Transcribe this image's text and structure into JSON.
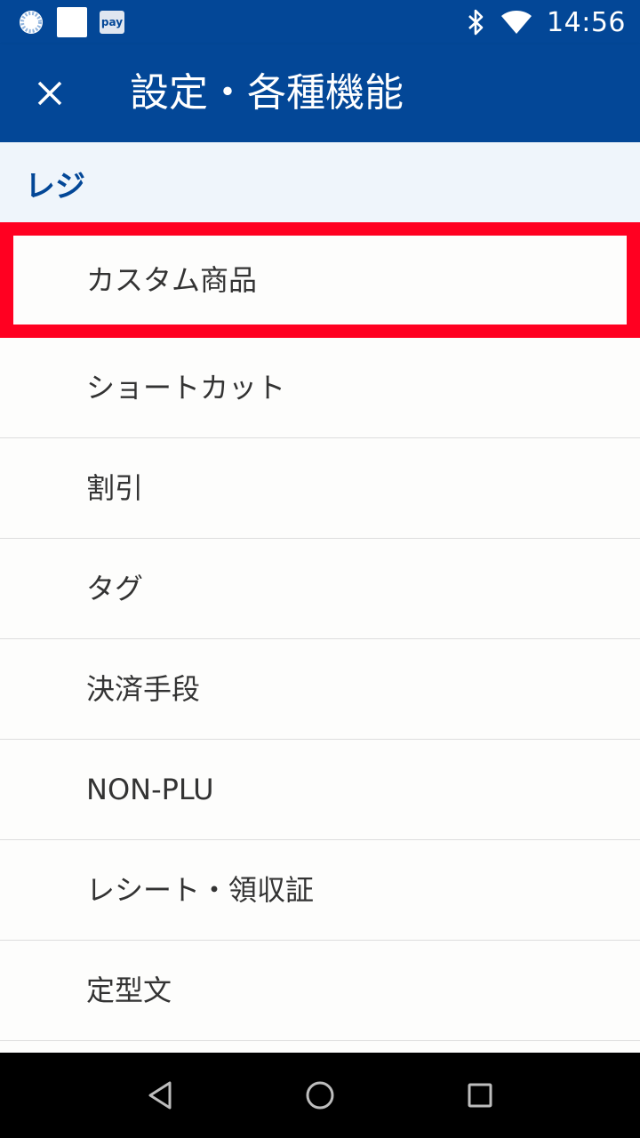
{
  "status_bar": {
    "pay_badge": "pay",
    "time": "14:56"
  },
  "app_bar": {
    "title": "設定・各種機能"
  },
  "section": {
    "title": "レジ"
  },
  "menu": {
    "items": [
      {
        "label": "カスタム商品",
        "highlighted": true
      },
      {
        "label": "ショートカット"
      },
      {
        "label": "割引"
      },
      {
        "label": "タグ"
      },
      {
        "label": "決済手段"
      },
      {
        "label": "NON-PLU"
      },
      {
        "label": "レシート・領収証"
      },
      {
        "label": "定型文"
      }
    ]
  },
  "colors": {
    "primary": "#034797",
    "highlight": "#ff0021",
    "section_bg": "#eff5fb"
  },
  "icons": {
    "status_left": [
      "loading-spinner-icon",
      "notification-square-icon",
      "pay-app-icon"
    ],
    "status_right": [
      "bluetooth-icon",
      "wifi-icon"
    ],
    "app_bar": "close-icon",
    "navigation": [
      "back-icon",
      "home-icon",
      "recents-icon"
    ]
  }
}
